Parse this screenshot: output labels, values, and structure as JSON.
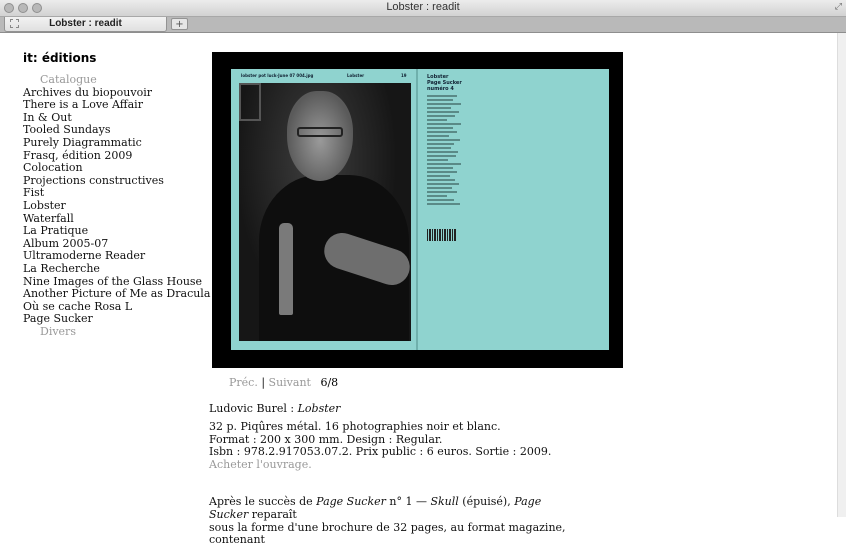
{
  "window": {
    "title": "Lobster : readit"
  },
  "tabs": [
    {
      "label": "Lobster : readit"
    }
  ],
  "newtab": {
    "label": "+"
  },
  "site": {
    "brand": "it: éditions"
  },
  "nav": {
    "catalogue_label": "Catalogue",
    "items": [
      "Archives du biopouvoir",
      "There is a Love Affair",
      "In & Out",
      "Tooled Sundays",
      "Purely Diagrammatic",
      "Frasq, édition 2009",
      "Colocation",
      "Projections constructives",
      "Fist",
      "Lobster",
      "Waterfall",
      "La Pratique",
      "Album 2005-07",
      "Ultramoderne Reader",
      "La Recherche",
      "Nine Images of the Glass House",
      "Another Picture of Me as Dracula",
      "Où se cache Rosa L",
      "Page Sucker"
    ],
    "divers_label": "Divers"
  },
  "viewer": {
    "left_page_header": "lobster pot luck-June 07 004.jpg",
    "left_page_title": "Lobster",
    "left_page_number": "19",
    "right_page_title": "Lobster",
    "right_page_subtitle": "Page Sucker",
    "right_page_issue": "numéro 4"
  },
  "pager": {
    "prev_label": "Préc.",
    "separator": "|",
    "next_label": "Suivant",
    "count": "6/8"
  },
  "caption": {
    "author": "Ludovic Burel : ",
    "title": "Lobster"
  },
  "details": {
    "line1": "32 p. Piqûres métal. 16 photographies noir et blanc.",
    "line2": "Format : 200 x 300 mm. Design : Regular.",
    "line3": "Isbn : 978.2.917053.07.2. Prix public : 6 euros. Sortie : 2009.",
    "buy_label": "Acheter l'ouvrage."
  },
  "body": {
    "p1_a": "Après le succès de ",
    "p1_b": "Page Sucker",
    "p1_c": " n° 1 — ",
    "p1_d": "Skull",
    "p1_e": " (épuisé), ",
    "p1_f": "Page Sucker",
    "p1_g": " reparaît",
    "p2": "sous la forme d'une brochure de 32 pages, au format magazine, contenant"
  }
}
